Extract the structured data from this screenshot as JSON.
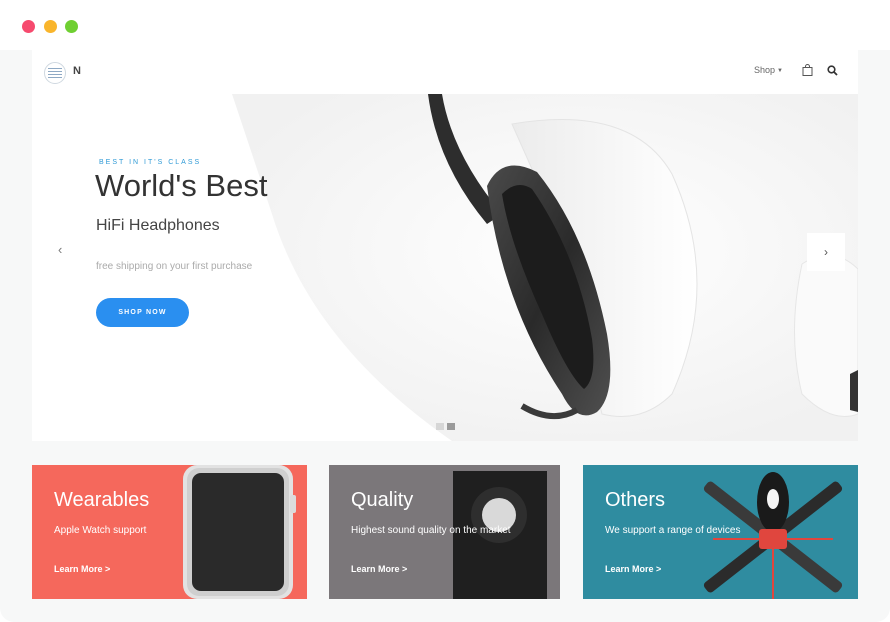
{
  "window": {
    "controls": [
      "close",
      "minimize",
      "maximize"
    ],
    "colors": {
      "close": "#f64a6e",
      "minimize": "#f9b52c",
      "maximize": "#6fcf32"
    }
  },
  "navbar": {
    "logo_letter": "N",
    "menu": [
      {
        "label": "Shop",
        "has_dropdown": true
      }
    ],
    "icons": [
      "bag-icon",
      "search-icon"
    ]
  },
  "hero": {
    "kicker": "BEST IN IT'S CLASS",
    "title": "World's Best",
    "subtitle": "HiFi Headphones",
    "note": "free shipping on your first purchase",
    "cta_label": "SHOP NOW",
    "prev_icon": "chevron-left-icon",
    "next_icon": "chevron-right-icon",
    "slide_count": 2,
    "active_slide": 2,
    "accent_color": "#2a8ff0"
  },
  "cards": [
    {
      "title": "Wearables",
      "description": "Apple Watch support",
      "link": "Learn More >",
      "color": "#f5685c"
    },
    {
      "title": "Quality",
      "description": "Highest sound quality on the market",
      "link": "Learn More >",
      "color": "#7b777a"
    },
    {
      "title": "Others",
      "description": "We support a range of devices",
      "link": "Learn More >",
      "color": "#2f8ca0"
    }
  ]
}
